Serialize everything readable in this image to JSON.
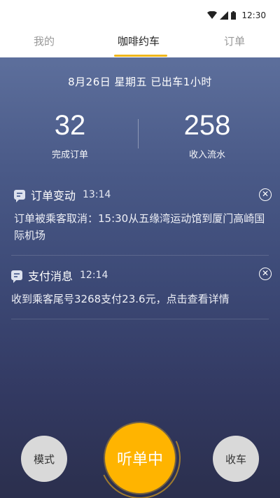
{
  "status_bar": {
    "time": "12:30",
    "icons": [
      "wifi-icon",
      "signal-icon",
      "battery-icon"
    ]
  },
  "tabs": [
    {
      "label": "我的",
      "active": false
    },
    {
      "label": "咖啡约车",
      "active": true
    },
    {
      "label": "订单",
      "active": false
    }
  ],
  "summary": {
    "date_line": "8月26日   星期五   已出车1小时",
    "orders_count": "32",
    "orders_label": "完成订单",
    "income": "258",
    "income_label": "收入流水"
  },
  "messages": [
    {
      "icon": "message-icon",
      "title": "订单变动",
      "time": "13:14",
      "body": "订单被乘客取消：15:30从五缘湾运动馆到厦门高崎国际机场"
    },
    {
      "icon": "message-icon",
      "title": "支付消息",
      "time": "12:14",
      "body": "收到乘客尾号3268支付23.6元，点击查看详情"
    }
  ],
  "controls": {
    "mode_label": "模式",
    "listen_label": "听单中",
    "stop_label": "收车"
  },
  "colors": {
    "accent": "#ffb400",
    "tab_underline": "#f0b71a",
    "bg_top": "#5d6f9c",
    "bg_bottom": "#2b2f4d"
  }
}
